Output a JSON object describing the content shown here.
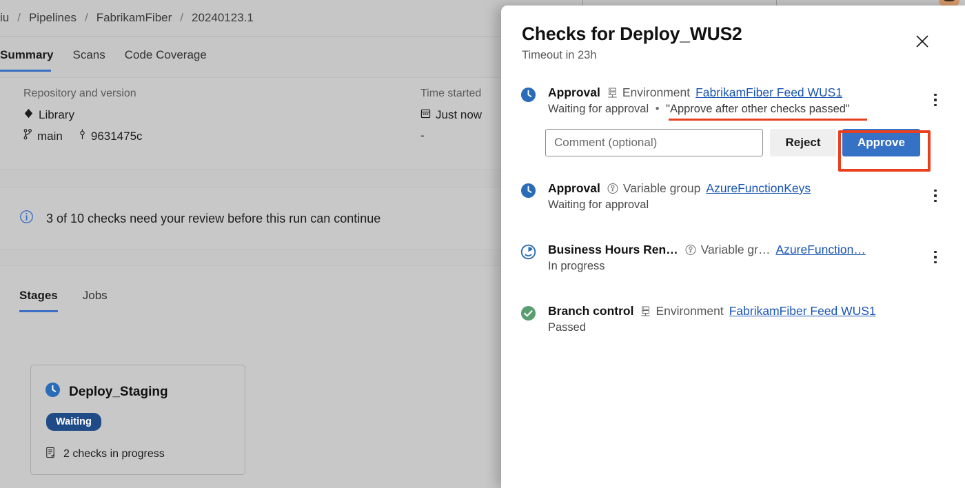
{
  "breadcrumb": {
    "items": [
      "iu",
      "Pipelines",
      "FabrikamFiber",
      "20240123.1"
    ],
    "separator": "/"
  },
  "tabs": [
    {
      "label": "Summary",
      "active": true
    },
    {
      "label": "Scans",
      "active": false
    },
    {
      "label": "Code Coverage",
      "active": false
    }
  ],
  "summary": {
    "repo_header": "Repository and version",
    "repo_name": "Library",
    "branch": "main",
    "commit": "9631475c",
    "time_header": "Time started",
    "time_value": "Just now",
    "time_elapsed": "-"
  },
  "info_banner": {
    "text": "3 of 10 checks need your review before this run can continue"
  },
  "stages_section": {
    "tabs": [
      {
        "label": "Stages",
        "active": true
      },
      {
        "label": "Jobs",
        "active": false
      }
    ],
    "card": {
      "name": "Deploy_Staging",
      "badge": "Waiting",
      "footer": "2 checks in progress"
    }
  },
  "panel": {
    "title": "Checks for Deploy_WUS2",
    "subtitle": "Timeout in 23h",
    "close_label": "Close",
    "checks": [
      {
        "name": "Approval",
        "meta_icon": "environment-icon",
        "meta_kind": "Environment",
        "meta_link": "FabrikamFiber Feed WUS1",
        "status": "Waiting for approval",
        "separator": "•",
        "quote": "\"Approve after other checks passed\"",
        "status_icon": "clock-filled-icon",
        "has_actions": true,
        "menu_label": "More options"
      },
      {
        "name": "Approval",
        "meta_icon": "variable-group-icon",
        "meta_kind": "Variable group",
        "meta_link": "AzureFunctionKeys",
        "status": "Waiting for approval",
        "separator": "",
        "quote": "",
        "status_icon": "clock-filled-icon",
        "has_actions": false,
        "menu_label": "More options"
      },
      {
        "name": "Business Hours Ren…",
        "meta_icon": "variable-group-icon",
        "meta_kind": "Variable gr…",
        "meta_link": "AzureFunction…",
        "status": "In progress",
        "separator": "",
        "quote": "",
        "status_icon": "in-progress-icon",
        "has_actions": false,
        "menu_label": "More options"
      },
      {
        "name": "Branch control",
        "meta_icon": "environment-icon",
        "meta_kind": "Environment",
        "meta_link": "FabrikamFiber Feed WUS1",
        "status": "Passed",
        "separator": "",
        "quote": "",
        "status_icon": "success-check-icon",
        "has_actions": false,
        "menu_label": ""
      }
    ],
    "actions": {
      "comment_placeholder": "Comment (optional)",
      "comment_value": "",
      "reject_label": "Reject",
      "approve_label": "Approve"
    }
  },
  "colors": {
    "accent_blue": "#3572c6",
    "link_blue": "#1a55b3",
    "tab_underline": "#3b6fc4",
    "annotation_red": "#e8401f",
    "badge_waiting": "#1f4b87",
    "success_green": "#5a9e6f",
    "scrim": "#c6c6c6"
  }
}
